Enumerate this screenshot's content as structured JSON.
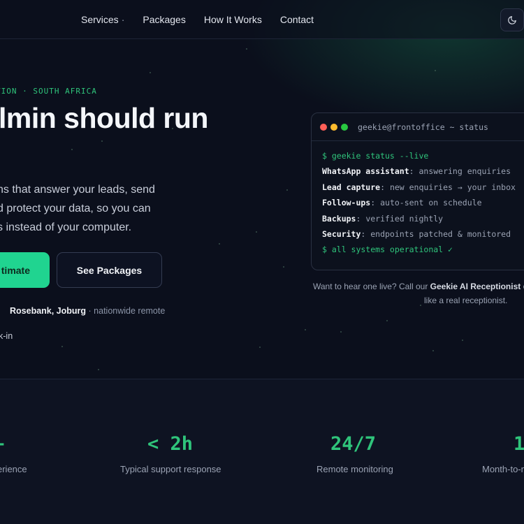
{
  "nav": {
    "links": [
      "Services",
      "Packages",
      "How It Works",
      "Contact"
    ],
    "theme_toggle_icon": "moon-icon"
  },
  "hero": {
    "eyebrow": "TION · SOUTH AFRICA",
    "headline": "lmin should run",
    "description_lines": [
      "ns that answer your leads, send",
      "d protect your data, so you can",
      "s instead of your computer."
    ],
    "primary_button": "timate",
    "secondary_button": "See Packages",
    "location_strong": "Rosebank, Joburg",
    "location_rest": "· nationwide remote",
    "checkin": "k-in"
  },
  "terminal": {
    "title": "geekie@frontoffice ~ status",
    "dot_colors": [
      "#ff5f57",
      "#febc2e",
      "#28c840"
    ],
    "lines": [
      {
        "key": "",
        "value": "$ geekie status --live",
        "style": "green"
      },
      {
        "key": "WhatsApp assistant",
        "value": ": answering enquiries",
        "style": ""
      },
      {
        "key": "Lead capture",
        "value": ": new enquiries → your inbox",
        "style": ""
      },
      {
        "key": "Follow-ups",
        "value": ": auto-sent on schedule",
        "style": ""
      },
      {
        "key": "Backups",
        "value": ": verified nightly",
        "style": ""
      },
      {
        "key": "Security",
        "value": ": endpoints patched & monitored",
        "style": ""
      },
      {
        "key": "",
        "value": "$ all systems operational ✓",
        "style": "green"
      }
    ]
  },
  "caption": {
    "prefix": "Want to hear one live? Call our ",
    "strong": "Geekie AI Receptionist",
    "suffix": " o",
    "line2": "like a real receptionist."
  },
  "stats": [
    {
      "value": "+",
      "label": "erience"
    },
    {
      "value": "< 2h",
      "label": "Typical support response"
    },
    {
      "value": "24/7",
      "label": "Remote monitoring"
    },
    {
      "value": "1",
      "label": "Month-to-m"
    }
  ],
  "colors": {
    "accent": "#2fc47b",
    "primary_button": "#20d490",
    "background": "#0b0f1c"
  }
}
